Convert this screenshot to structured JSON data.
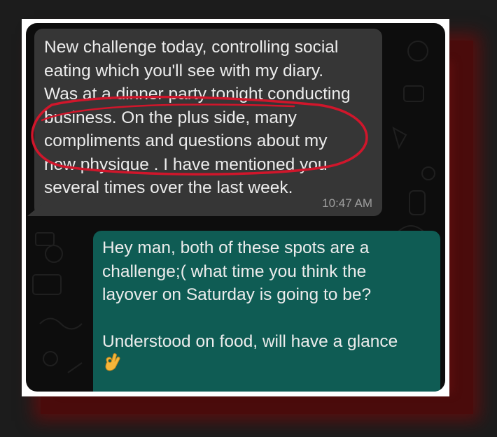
{
  "incoming_message": {
    "text": "New challenge today, controlling social\neating which you'll see with my diary.\nWas at a dinner party tonight conducting\nbusiness. On the plus side, many\ncompliments and questions about my\nnew physique .  I have mentioned you\nseveral times over the last week.",
    "time": "10:47 AM"
  },
  "outgoing_message": {
    "text": "Hey man, both of these spots are a\nchallenge;( what time you think the\nlayover on Saturday is going to be?\n\nUnderstood on food, will have a glance",
    "emoji": "ok-hand-icon"
  },
  "colors": {
    "incoming_bubble": "#363636",
    "outgoing_bubble": "#0f5c54",
    "annotation_circle": "#d0162b",
    "glow": "#5c0e0e"
  }
}
